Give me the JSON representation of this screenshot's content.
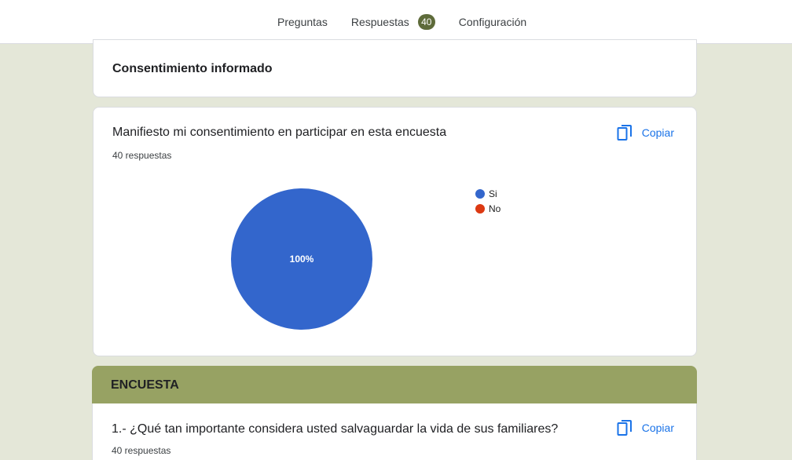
{
  "tabs": [
    {
      "label": "Preguntas"
    },
    {
      "label": "Respuestas",
      "badge": "40"
    },
    {
      "label": "Configuración"
    }
  ],
  "consent_section": {
    "title": "Consentimiento informado"
  },
  "question1": {
    "title": "Manifiesto mi consentimiento en participar en esta encuesta",
    "count": "40 respuestas",
    "copy_label": "Copiar",
    "chart_data": {
      "type": "pie",
      "categories": [
        "Si",
        "No"
      ],
      "values": [
        100,
        0
      ],
      "colors": [
        "#3366cc",
        "#dc3912"
      ],
      "slice_label": "100%",
      "legend": "right"
    }
  },
  "section2": {
    "title": "ENCUESTA"
  },
  "question2": {
    "title": "1.- ¿Qué tan importante considera usted salvaguardar la vida de sus familiares?",
    "count": "40 respuestas",
    "copy_label": "Copiar"
  }
}
